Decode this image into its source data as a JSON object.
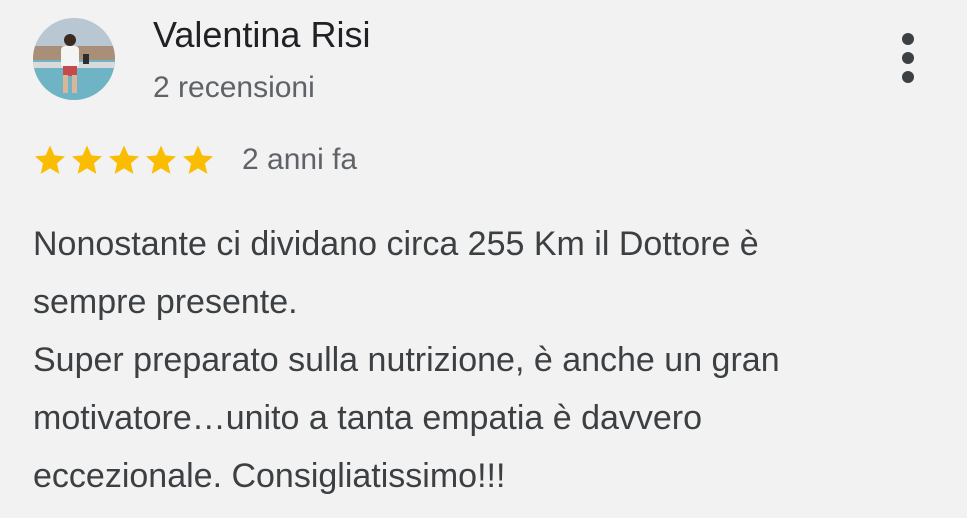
{
  "review": {
    "author": {
      "name": "Valentina Risi",
      "review_count": "2 recensioni",
      "avatar_icon": "user-photo"
    },
    "more_options_icon": "more-vert-icon",
    "rating": {
      "stars": 5,
      "max_stars": 5,
      "star_color": "#fbbc04",
      "date": "2 anni fa"
    },
    "text_lines": [
      "Nonostante ci dividano circa 255 Km il Dottore è",
      "sempre presente.",
      "Super preparato sulla nutrizione, è anche un gran",
      "motivatore…unito a tanta empatia è davvero",
      "eccezionale. Consigliatissimo!!!"
    ]
  }
}
